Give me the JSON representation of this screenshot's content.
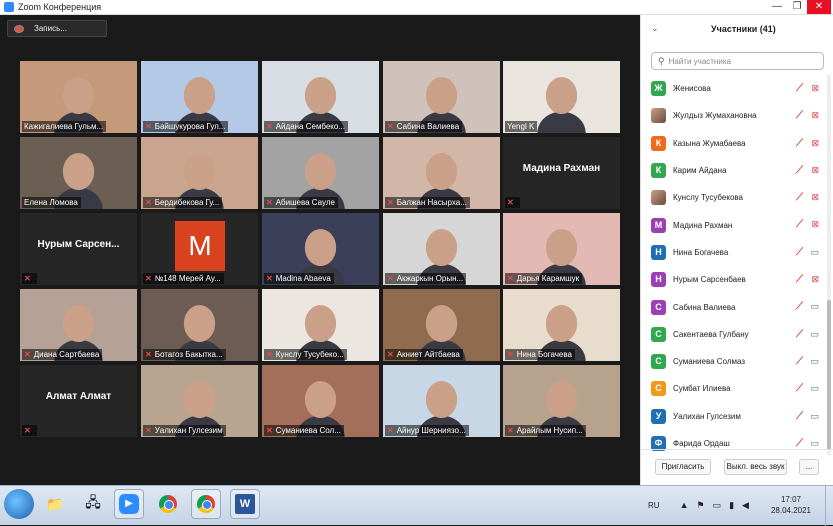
{
  "window": {
    "title": "Zoom Конференция",
    "min": "—",
    "max": "❐",
    "close": "✕"
  },
  "toolbar": {
    "record_label": "Запись..."
  },
  "tiles": [
    {
      "name": "Кажигалиева Гульм...",
      "muted": false,
      "video": true,
      "active": true,
      "color": "#c49a7a"
    },
    {
      "name": "Байшукурова Гул...",
      "muted": true,
      "video": true,
      "color": "#b3c9e6"
    },
    {
      "name": "Айдана Сембеко...",
      "muted": true,
      "video": true,
      "color": "#d7dde3"
    },
    {
      "name": "Сабина Валиева",
      "muted": true,
      "video": true,
      "color": "#cfc2ba"
    },
    {
      "name": "Yengl K",
      "muted": false,
      "video": true,
      "color": "#e9e4dd"
    },
    {
      "name": "Елена Ломова",
      "muted": false,
      "video": true,
      "color": "#6b5e52"
    },
    {
      "name": "Бердибекова Гу...",
      "muted": true,
      "video": true,
      "color": "#c9a48e"
    },
    {
      "name": "Абишева Сауле",
      "muted": true,
      "video": true,
      "color": "#a3a3a3"
    },
    {
      "name": "Балжан Насырха...",
      "muted": true,
      "video": true,
      "color": "#d2b6a8"
    },
    {
      "name": "",
      "big_name": "Мадина Рахман",
      "muted": true,
      "video": false
    },
    {
      "name": "",
      "big_name": "Нурым Сарсен...",
      "muted": true,
      "video": false
    },
    {
      "name": "№148 Мерей Ау...",
      "muted": true,
      "video": false,
      "avatar": "M"
    },
    {
      "name": "Madina Abaeva",
      "muted": true,
      "video": true,
      "color": "#3b3f5a"
    },
    {
      "name": "Акжаркын Орын...",
      "muted": true,
      "video": true,
      "color": "#d6d6d6"
    },
    {
      "name": "Дарья Карамшук",
      "muted": true,
      "video": true,
      "color": "#e3b9b4"
    },
    {
      "name": "Диана Сартбаева",
      "muted": true,
      "video": true,
      "color": "#b5a195"
    },
    {
      "name": "Ботагоз Бакытка...",
      "muted": true,
      "video": true,
      "color": "#6d5c53"
    },
    {
      "name": "Кунслу Тусубеко...",
      "muted": true,
      "video": true,
      "color": "#ece6e1"
    },
    {
      "name": "Акниет Айтбаева",
      "muted": true,
      "video": true,
      "color": "#8f6b50"
    },
    {
      "name": "Нина Богачева",
      "muted": true,
      "video": true,
      "color": "#e8dccc"
    },
    {
      "name": "",
      "big_name": "Алмат Алмат",
      "muted": true,
      "video": false
    },
    {
      "name": "Уалихан Гулсезим",
      "muted": true,
      "video": true,
      "color": "#b9a48f"
    },
    {
      "name": "Суманиева Сол...",
      "muted": true,
      "video": true,
      "color": "#a36e5a"
    },
    {
      "name": "Айнур Шерниязо...",
      "muted": true,
      "video": true,
      "color": "#c7d7e5"
    },
    {
      "name": "Арайлым Нусип...",
      "muted": true,
      "video": true,
      "color": "#b7a28e"
    }
  ],
  "panel": {
    "title": "Участники (41)",
    "search_placeholder": "Найти участника",
    "participants": [
      {
        "initial": "Ж",
        "name": "Женисова",
        "color": "#2fa84f",
        "cam": "off-red"
      },
      {
        "initial": "",
        "name": "Жулдыз Жумахановна",
        "color": "photo",
        "cam": "off-red"
      },
      {
        "initial": "К",
        "name": "Казына Жумабаева",
        "color": "#ef6c1a",
        "cam": "off-red"
      },
      {
        "initial": "К",
        "name": "Карим Айдана",
        "color": "#2fa84f",
        "cam": "off-red"
      },
      {
        "initial": "",
        "name": "Кунслу Тусубекова",
        "color": "photo",
        "cam": "off-red"
      },
      {
        "initial": "М",
        "name": "Мадина Рахман",
        "color": "#9b3fb5",
        "cam": "off-red"
      },
      {
        "initial": "Н",
        "name": "Нина Богачева",
        "color": "#1f6fb5",
        "cam": "on"
      },
      {
        "initial": "Н",
        "name": "Нурым Сарсенбаев",
        "color": "#9b3fb5",
        "cam": "off-red"
      },
      {
        "initial": "С",
        "name": "Сабина Валиева",
        "color": "#9b3fb5",
        "cam": "on"
      },
      {
        "initial": "С",
        "name": "Сакентаева Гулбану",
        "color": "#2fa84f",
        "cam": "on"
      },
      {
        "initial": "С",
        "name": "Суманиева Солмаз",
        "color": "#2fa84f",
        "cam": "on"
      },
      {
        "initial": "С",
        "name": "Сумбат Илиева",
        "color": "#ef9a1a",
        "cam": "on"
      },
      {
        "initial": "У",
        "name": "Уалихан Гулсезим",
        "color": "#1f6fb5",
        "cam": "on"
      },
      {
        "initial": "Ф",
        "name": "Фарида Ордаш",
        "color": "#1f6fb5",
        "cam": "on"
      }
    ],
    "invite_label": "Пригласить",
    "mute_all_label": "Выкл. весь звук",
    "more_label": "..."
  },
  "taskbar": {
    "lang": "RU",
    "time": "17:07",
    "date": "28.04.2021"
  }
}
